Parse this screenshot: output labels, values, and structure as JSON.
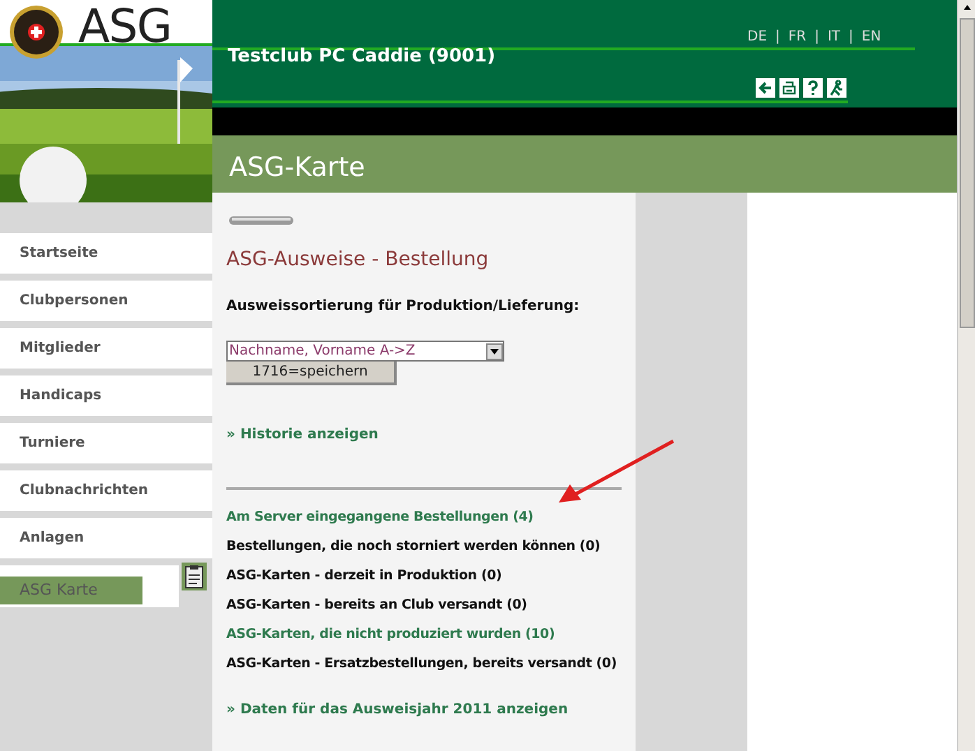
{
  "logo": {
    "text": "ASG"
  },
  "header": {
    "club": "Testclub PC Caddie (9001)",
    "languages": [
      "DE",
      "FR",
      "IT",
      "EN"
    ],
    "separator": "|"
  },
  "page_title": "ASG-Karte",
  "sidebar": {
    "items": [
      {
        "label": "Startseite",
        "selected": false
      },
      {
        "label": "Clubpersonen",
        "selected": false
      },
      {
        "label": "Mitglieder",
        "selected": false
      },
      {
        "label": "Handicaps",
        "selected": false
      },
      {
        "label": "Turniere",
        "selected": false
      },
      {
        "label": "Clubnachrichten",
        "selected": false
      },
      {
        "label": "Anlagen",
        "selected": false
      },
      {
        "label": "ASG Karte",
        "selected": true
      }
    ]
  },
  "content": {
    "heading": "ASG-Ausweise - Bestellung",
    "sort_label": "Ausweissortierung für Produktion/Lieferung:",
    "sort_value": "Nachname, Vorname A->Z",
    "save_button": "1716=speichern",
    "history_link": "» Historie anzeigen",
    "items": [
      {
        "kind": "link",
        "text": "Am Server eingegangene Bestellungen (4)"
      },
      {
        "kind": "plain",
        "text": "Bestellungen, die noch storniert werden können (0)"
      },
      {
        "kind": "plain",
        "text": "ASG-Karten - derzeit in Produktion (0)"
      },
      {
        "kind": "plain",
        "text": "ASG-Karten - bereits an Club versandt (0)"
      },
      {
        "kind": "link",
        "text": "ASG-Karten, die nicht produziert wurden (10)"
      },
      {
        "kind": "plain",
        "text": "ASG-Karten - Ersatzbestellungen, bereits versandt (0)"
      }
    ],
    "year_link": "» Daten für das Ausweisjahr 2011 anzeigen"
  }
}
